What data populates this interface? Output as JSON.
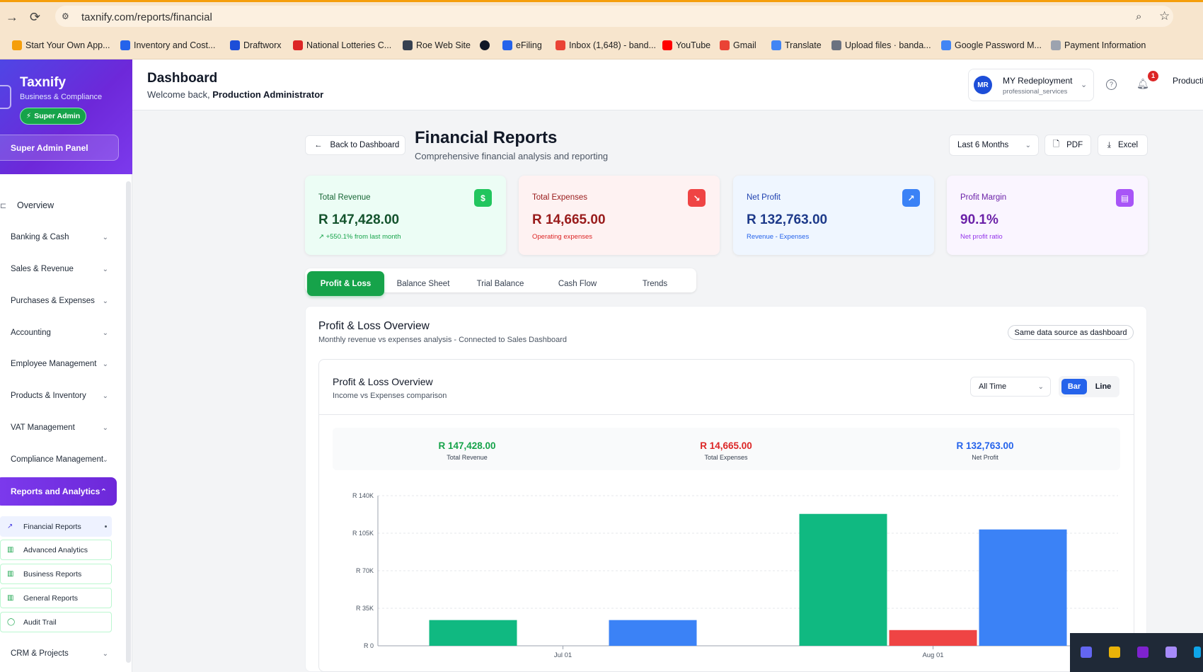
{
  "browser": {
    "url": "taxnify.com/reports/financial",
    "bookmarks": [
      "Start Your Own App...",
      "Inventory and Cost...",
      "Draftworx",
      "National Lotteries C...",
      "Roe Web Site",
      "",
      "eFiling",
      "Inbox (1,648) - band...",
      "YouTube",
      "Gmail",
      "Translate",
      "Upload files · banda...",
      "Google Password M...",
      "Payment Information"
    ]
  },
  "sidebar": {
    "brand_title": "Taxnify",
    "brand_sub": "Business & Compliance",
    "badge": "Super Admin",
    "panel": "Super Admin Panel",
    "overview": "Overview",
    "items": [
      "Banking & Cash",
      "Sales & Revenue",
      "Purchases & Expenses",
      "Accounting",
      "Employee Management",
      "Products & Inventory",
      "VAT Management",
      "Compliance Management"
    ],
    "active": "Reports and Analytics",
    "subitems": [
      "Financial Reports",
      "Advanced Analytics",
      "Business Reports",
      "General Reports",
      "Audit Trail"
    ],
    "crm": "CRM & Projects"
  },
  "header": {
    "title": "Dashboard",
    "welcome_prefix": "Welcome back,",
    "welcome_user": "Production Administrator",
    "org_initials": "MR",
    "org_name": "MY Redeployment",
    "org_type": "professional_services",
    "notif_count": "1",
    "user_truncated": "Producti"
  },
  "page": {
    "back_label": "Back to Dashboard",
    "title": "Financial Reports",
    "subtitle": "Comprehensive financial analysis and reporting",
    "period": "Last 6 Months",
    "pdf": "PDF",
    "excel": "Excel"
  },
  "kpis": [
    {
      "label": "Total Revenue",
      "value": "R 147,428.00",
      "note": "↗ +550.1% from last month",
      "icon": "dollar-icon"
    },
    {
      "label": "Total Expenses",
      "value": "R 14,665.00",
      "note": "Operating expenses",
      "icon": "trending-down-icon"
    },
    {
      "label": "Net Profit",
      "value": "R 132,763.00",
      "note": "Revenue - Expenses",
      "icon": "trending-up-icon"
    },
    {
      "label": "Profit Margin",
      "value": "90.1%",
      "note": "Net profit ratio",
      "icon": "document-icon"
    }
  ],
  "tabs": [
    "Profit & Loss",
    "Balance Sheet",
    "Trial Balance",
    "Cash Flow",
    "Trends"
  ],
  "overview": {
    "title": "Profit & Loss Overview",
    "subtitle": "Monthly revenue vs expenses analysis - Connected to Sales Dashboard",
    "badge": "Same data source as dashboard"
  },
  "chart_card": {
    "title": "Profit & Loss Overview",
    "subtitle": "Income vs Expenses comparison",
    "range": "All Time",
    "toggle_bar": "Bar",
    "toggle_line": "Line",
    "summary": [
      {
        "value": "R 147,428.00",
        "label": "Total Revenue",
        "color": "#16a34a"
      },
      {
        "value": "R 14,665.00",
        "label": "Total Expenses",
        "color": "#dc2626"
      },
      {
        "value": "R 132,763.00",
        "label": "Net Profit",
        "color": "#2563eb"
      }
    ]
  },
  "chart_data": {
    "type": "bar",
    "categories": [
      "Jul 01",
      "Aug 01"
    ],
    "yticks": [
      "R 0",
      "R 35K",
      "R 70K",
      "R 105K",
      "R 140K"
    ],
    "ylim": [
      0,
      140000
    ],
    "series": [
      {
        "name": "Total Revenue",
        "color": "#10b981",
        "values": [
          24000,
          123000
        ]
      },
      {
        "name": "Total Expenses",
        "color": "#ef4444",
        "values": [
          0,
          14665
        ]
      },
      {
        "name": "Net Profit",
        "color": "#3b82f6",
        "values": [
          24000,
          108500
        ]
      }
    ],
    "grid": true
  },
  "colors": {
    "accent_green": "#16a34a",
    "accent_purple": "#7c3aed",
    "accent_blue": "#2563eb",
    "danger": "#dc2626"
  }
}
